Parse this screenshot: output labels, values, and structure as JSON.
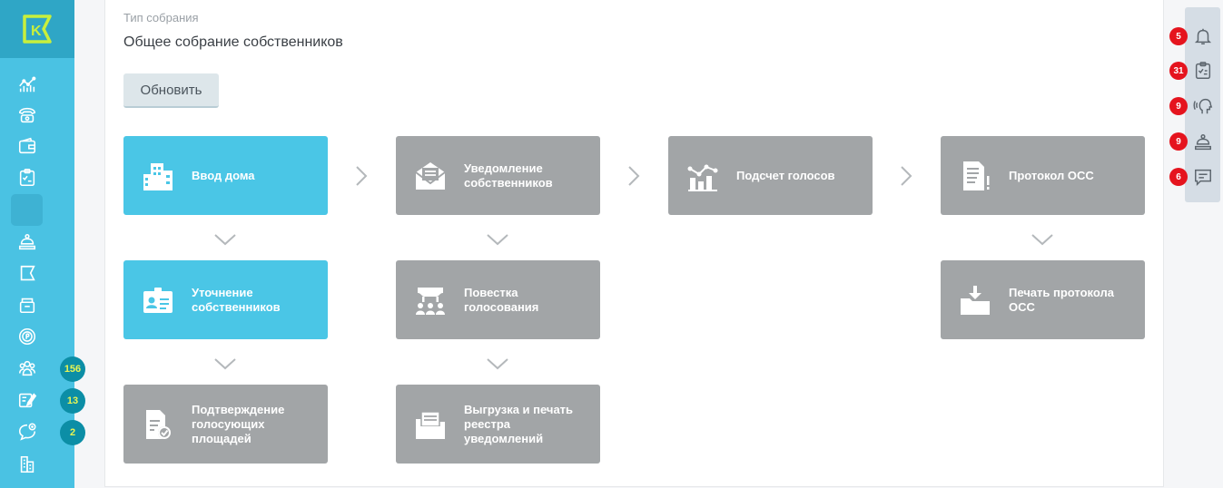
{
  "app": {
    "logo_letter": "K"
  },
  "sidebar": {
    "items": [
      {
        "name": "analytics",
        "icon": "analytics-icon"
      },
      {
        "name": "phone",
        "icon": "phone-icon"
      },
      {
        "name": "wallet",
        "icon": "wallet-icon"
      },
      {
        "name": "tasks",
        "icon": "clipboard-check-icon"
      },
      {
        "name": "active",
        "icon": "blank-icon"
      },
      {
        "name": "reception",
        "icon": "reception-bell-icon"
      },
      {
        "name": "flag",
        "icon": "flag-icon"
      },
      {
        "name": "archive",
        "icon": "box-icon"
      },
      {
        "name": "payments",
        "icon": "coin-icon"
      },
      {
        "name": "people",
        "icon": "people-icon",
        "badge": "156"
      },
      {
        "name": "edit",
        "icon": "edit-icon",
        "badge": "13"
      },
      {
        "name": "chat-add",
        "icon": "chat-add-icon",
        "badge": "2"
      },
      {
        "name": "building",
        "icon": "building-icon"
      }
    ]
  },
  "meeting": {
    "type_label": "Тип собрания",
    "type_value": "Общее собрание собственников",
    "refresh_label": "Обновить"
  },
  "steps": {
    "house_input": "Ввод дома",
    "owners_notification": "Уведомление собственников",
    "vote_count": "Подсчет голосов",
    "protocol": "Протокол ОСС",
    "owners_clarification": "Уточнение собственников",
    "agenda": "Повестка голосования",
    "print_protocol": "Печать протокола ОСС",
    "areas_confirmation": "Подтверждение голосующих площадей",
    "export_registry": "Выгрузка и печать реестра уведомлений"
  },
  "right_panel": {
    "notifications_badge": "5",
    "tasks_badge": "31",
    "calls_badge": "9",
    "reception_badge": "9",
    "messages_badge": "6"
  },
  "colors": {
    "sidebar": "#4ac2e3",
    "logo_bg": "#2fa6c6",
    "logo_accent": "#c8ef3c",
    "step_active": "#4ac6e6",
    "step_inactive": "#a2a5a7",
    "badge_teal": "#0c8ea6",
    "badge_red": "#e5141e"
  }
}
